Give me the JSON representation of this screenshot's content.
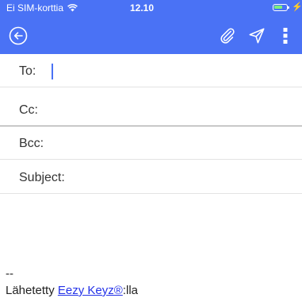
{
  "status_bar": {
    "carrier": "Ei SIM-korttia",
    "time": "12.10",
    "battery_fill": 0.7,
    "charging": "⚡"
  },
  "toolbar": {
    "back_icon": "back-circle-icon",
    "attach_icon": "paperclip-icon",
    "send_icon": "send-icon",
    "menu_icon": "more-vert-icon",
    "accent": "#4a72f5"
  },
  "fields": {
    "to_label": "To:",
    "cc_label": "Cc:",
    "bcc_label": "Bcc:",
    "subject_label": "Subject:"
  },
  "signature": {
    "separator": "--",
    "prefix": "Lähetetty ",
    "link": "Eezy Keyz®",
    "suffix": ":lla"
  }
}
